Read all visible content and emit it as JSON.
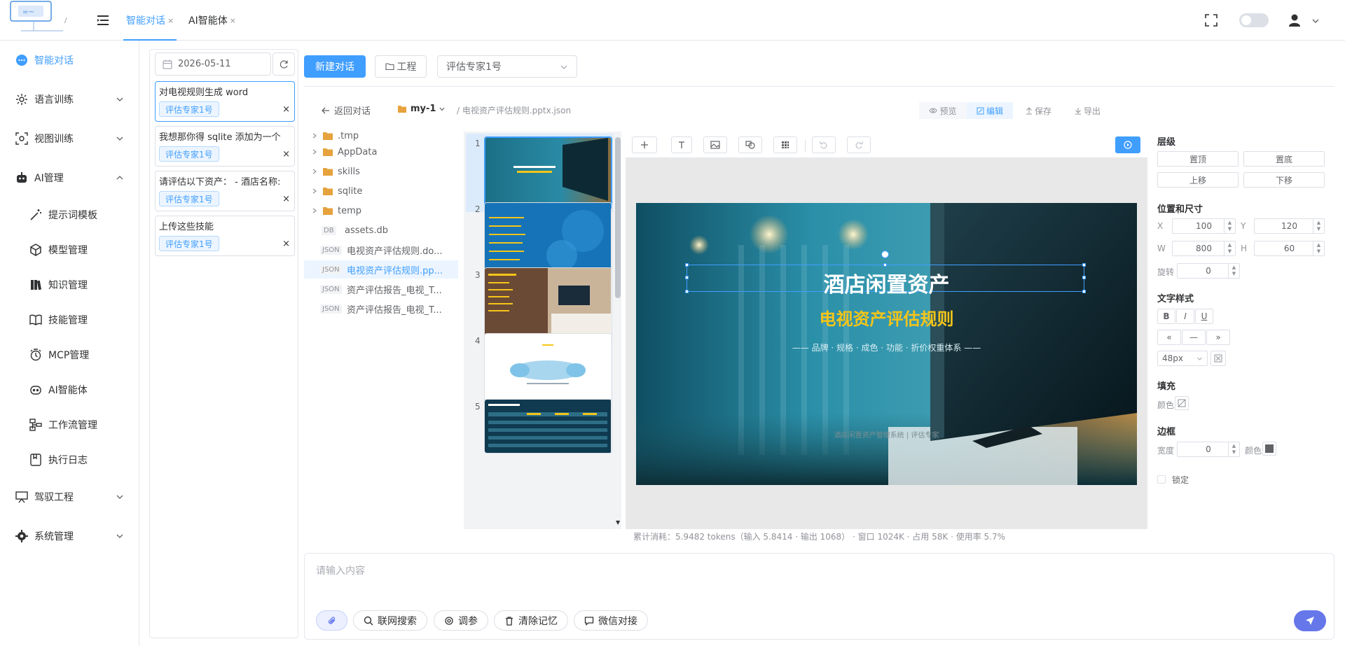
{
  "topbar": {
    "tabs": [
      {
        "label": "智能对话"
      },
      {
        "label": "AI智能体"
      }
    ],
    "tab_close": "×"
  },
  "sidebar": {
    "items": [
      {
        "label": "智能对话"
      },
      {
        "label": "语言训练"
      },
      {
        "label": "视图训练"
      },
      {
        "label": "AI管理"
      },
      {
        "label": "提示词模板"
      },
      {
        "label": "模型管理"
      },
      {
        "label": "知识管理"
      },
      {
        "label": "技能管理"
      },
      {
        "label": "MCP管理"
      },
      {
        "label": "AI智能体"
      },
      {
        "label": "工作流管理"
      },
      {
        "label": "执行日志"
      },
      {
        "label": "驾驭工程"
      },
      {
        "label": "系统管理"
      }
    ]
  },
  "history": {
    "date": "2026-05-11",
    "conversations": [
      {
        "title": "对电视规则生成 word",
        "tag": "评估专家1号",
        "close": "×"
      },
      {
        "title": "我想那你得 sqlite 添加为一个",
        "tag": "评估专家1号",
        "close": "×"
      },
      {
        "title": "请评估以下资产：  - 酒店名称:",
        "tag": "评估专家1号",
        "close": "×"
      },
      {
        "title": "上传这些技能",
        "tag": "评估专家1号",
        "close": "×"
      }
    ]
  },
  "toolbar": {
    "new_chat": "新建对话",
    "project": "工程",
    "agent_select": "评估专家1号"
  },
  "workspace": {
    "back": "返回对话",
    "project_name": "my-1",
    "path": "/ 电视资产评估规则.pptx.json",
    "actions": {
      "preview": "预览",
      "edit": "编辑",
      "save": "保存",
      "export": "导出"
    },
    "tree": [
      {
        "type": "folder",
        "label": ".tmp"
      },
      {
        "type": "folder",
        "label": "AppData"
      },
      {
        "type": "folder",
        "label": "skills"
      },
      {
        "type": "folder",
        "label": "sqlite"
      },
      {
        "type": "folder",
        "label": "temp"
      },
      {
        "type": "file",
        "badge": "DB",
        "label": "assets.db"
      },
      {
        "type": "file",
        "badge": "JSON",
        "label": "电视资产评估规则.do..."
      },
      {
        "type": "file",
        "badge": "JSON",
        "label": "电视资产评估规则.pp..."
      },
      {
        "type": "file",
        "badge": "JSON",
        "label": "资产评估报告_电视_T..."
      },
      {
        "type": "file",
        "badge": "JSON",
        "label": "资产评估报告_电视_T..."
      }
    ],
    "slide_numbers": [
      "1",
      "2",
      "3",
      "4",
      "5"
    ]
  },
  "slide": {
    "title": "酒店闲置资产",
    "subtitle": "电视资产评估规则",
    "tagline": "—— 品牌 · 规格 · 成色 · 功能 · 折价权重体系 ——",
    "footer": "酒店闲置资产管理系统 | 评估专家",
    "colors": {
      "title": "#ffffff",
      "subtitle": "#f5c518",
      "accent": "#409eff"
    }
  },
  "props": {
    "layer": {
      "title": "层级",
      "top": "置顶",
      "bottom": "置底",
      "up": "上移",
      "down": "下移"
    },
    "position": {
      "title": "位置和尺寸",
      "x_label": "X",
      "x": "100",
      "y_label": "Y",
      "y": "120",
      "w_label": "W",
      "w": "800",
      "h_label": "H",
      "h": "60",
      "rot_label": "旋转",
      "rot": "0"
    },
    "text": {
      "title": "文字样式",
      "bold": "B",
      "italic": "I",
      "underline": "U",
      "align_left": "«",
      "align_center": "—",
      "align_right": "»",
      "size": "48px"
    },
    "fill": {
      "title": "填充",
      "color_label": "颜色"
    },
    "border": {
      "title": "边框",
      "width_label": "宽度",
      "width": "0",
      "color_label": "颜色"
    },
    "lock": {
      "label": "锁定"
    }
  },
  "tokens": "累计消耗：5.9482 tokens（输入 5.8414 · 输出 1068） · 窗口 1024K · 占用 58K · 使用率 5.7%",
  "input": {
    "placeholder": "请输入内容",
    "chips": [
      {
        "label": "联网搜索"
      },
      {
        "label": "调参"
      },
      {
        "label": "清除记忆"
      },
      {
        "label": "微信对接"
      }
    ]
  }
}
